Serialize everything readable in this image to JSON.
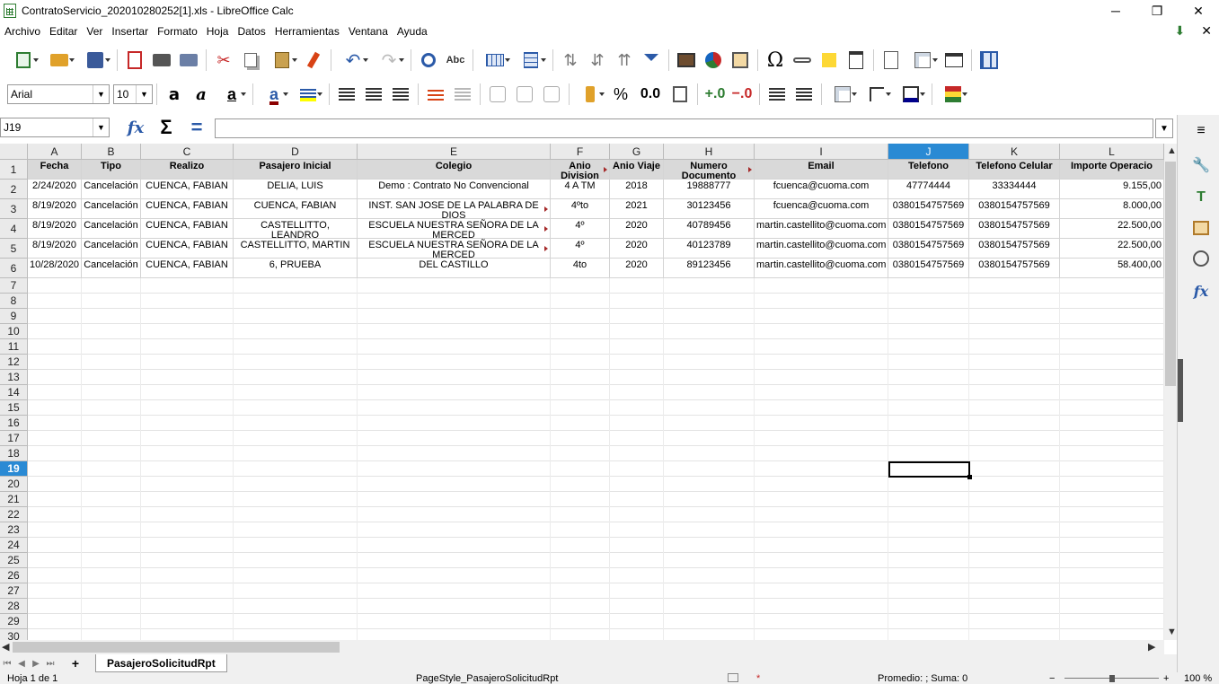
{
  "window": {
    "title": "ContratoServicio_202010280252[1].xls - LibreOffice Calc",
    "minimize": "─",
    "maximize": "❐",
    "close": "✕"
  },
  "menu": {
    "items": [
      "Archivo",
      "Editar",
      "Ver",
      "Insertar",
      "Formato",
      "Hoja",
      "Datos",
      "Herramientas",
      "Ventana",
      "Ayuda"
    ],
    "close_doc": "✕"
  },
  "toolbar1": {
    "icons": [
      "new-spreadsheet-icon",
      "open-folder-icon",
      "save-icon",
      "export-pdf-icon",
      "print-icon",
      "print-preview-icon",
      "cut-icon",
      "copy-icon",
      "paste-icon",
      "clone-formatting-icon",
      "undo-icon",
      "redo-icon",
      "find-replace-icon",
      "spelling-icon",
      "row-icon",
      "column-icon",
      "sort-ascending-icon",
      "sort-descending-icon",
      "sort-icon",
      "autofilter-icon",
      "insert-image-icon",
      "insert-chart-icon",
      "pivot-table-icon",
      "special-character-icon",
      "hyperlink-icon",
      "comment-icon",
      "headers-footers-icon",
      "define-print-area-icon",
      "freeze-rows-columns-icon",
      "split-window-icon",
      "show-sidebar-icon"
    ]
  },
  "toolbar2": {
    "font_name": "Arial",
    "font_size": "10",
    "bold": "a",
    "italic": "a",
    "underline": "a",
    "font_color": "a",
    "font_color_hex": "#8b0000",
    "highlight_hex": "#ffff00",
    "percent": "%",
    "number": "0.0",
    "border_color_hex": "#00008b"
  },
  "formula_bar": {
    "name_box": "J19",
    "function_wizard": "fx",
    "sum": "Σ",
    "equals": "=",
    "content": ""
  },
  "sheet": {
    "columns": [
      "A",
      "B",
      "C",
      "D",
      "E",
      "F",
      "G",
      "H",
      "I",
      "J",
      "K",
      "L"
    ],
    "active_column": "J",
    "active_row": "19",
    "header_row": [
      "Fecha",
      "Tipo",
      "Realizo",
      "Pasajero Inicial",
      "Colegio",
      "Anio Division",
      "Anio Viaje",
      "Numero Documento",
      "Email",
      "Telefono",
      "Telefono Celular",
      "Importe Operacio"
    ],
    "rows": [
      [
        "2/24/2020",
        "Cancelación",
        "CUENCA, FABIAN",
        "DELIA, LUIS",
        "Demo : Contrato No Convencional",
        "4 A TM",
        "2018",
        "19888777",
        "fcuenca@cuoma.com",
        "47774444",
        "33334444",
        "9.155,00"
      ],
      [
        "8/19/2020",
        "Cancelación",
        "CUENCA, FABIAN",
        "CUENCA, FABIAN",
        "INST. SAN JOSE DE LA PALABRA DE DIOS",
        "4ºto",
        "2021",
        "30123456",
        "fcuenca@cuoma.com",
        "0380154757569",
        "0380154757569",
        "8.000,00"
      ],
      [
        "8/19/2020",
        "Cancelación",
        "CUENCA, FABIAN",
        "CASTELLITTO, LEANDRO",
        "ESCUELA NUESTRA SEÑORA DE LA MERCED",
        "4º",
        "2020",
        "40789456",
        "martin.castellito@cuoma.com",
        "0380154757569",
        "0380154757569",
        "22.500,00"
      ],
      [
        "8/19/2020",
        "Cancelación",
        "CUENCA, FABIAN",
        "CASTELLITTO, MARTIN",
        "ESCUELA NUESTRA SEÑORA DE LA MERCED",
        "4º",
        "2020",
        "40123789",
        "martin.castellito@cuoma.com",
        "0380154757569",
        "0380154757569",
        "22.500,00"
      ],
      [
        "10/28/2020",
        "Cancelación",
        "CUENCA, FABIAN",
        "6, PRUEBA",
        "DEL CASTILLO",
        "4to",
        "2020",
        "89123456",
        "martin.castellito@cuoma.com",
        "0380154757569",
        "0380154757569",
        "58.400,00"
      ]
    ],
    "row_numbers": [
      "1",
      "2",
      "3",
      "4",
      "5",
      "6",
      "7",
      "8",
      "9",
      "10",
      "11",
      "12",
      "13",
      "14",
      "15",
      "16",
      "17",
      "18",
      "19",
      "20",
      "21",
      "22",
      "23",
      "24",
      "25",
      "26",
      "27",
      "28",
      "29",
      "30"
    ]
  },
  "tabs": {
    "add": "+",
    "sheets": [
      "PasajeroSolicitudRpt"
    ]
  },
  "status": {
    "sheet_info": "Hoja 1 de 1",
    "page_style": "PageStyle_PasajeroSolicitudRpt",
    "sum": "Promedio: ; Suma: 0",
    "zoom": "100 %"
  }
}
